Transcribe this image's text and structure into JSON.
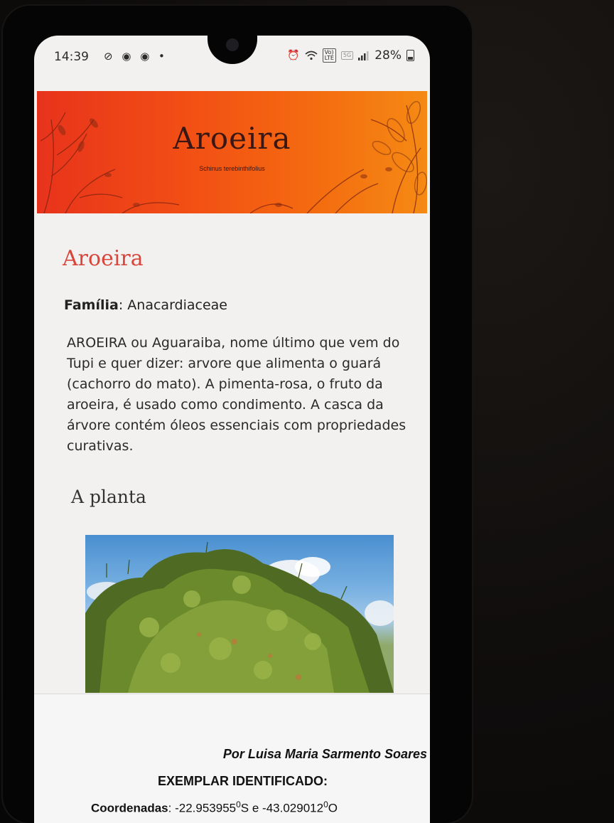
{
  "status_bar": {
    "time": "14:39",
    "left_icons": "⊘ ◉ ◉ •",
    "battery": "28%"
  },
  "banner": {
    "title": "Aroeira",
    "subtitle": "Schinus terebinthifolius",
    "colors": {
      "start": "#e8331c",
      "end": "#f58a14",
      "ink": "#3a1713"
    }
  },
  "page": {
    "heading": "Aroeira",
    "family_label": "Família",
    "family_value": ": Anacardiaceae",
    "description": "AROEIRA  ou Aguaraiba, nome último que vem do Tupi e quer dizer: arvore que alimenta o guará (cachorro do mato). A pimenta-rosa, o fruto da aroeira, é usado como condimento. A casca da árvore contém óleos essenciais com propriedades curativas.",
    "section_heading": "A planta",
    "heading_color": "#d9453b"
  },
  "footer": {
    "author": "Por Luisa Maria Sarmento Soares",
    "specimen_label": "EXEMPLAR IDENTIFICADO:",
    "coords_label": "Coordenadas",
    "coords_lat": ": -22.953955",
    "coords_lat_sup": "0",
    "coords_mid": "S e -43.029012",
    "coords_lon_sup": "0",
    "coords_end": "O"
  }
}
